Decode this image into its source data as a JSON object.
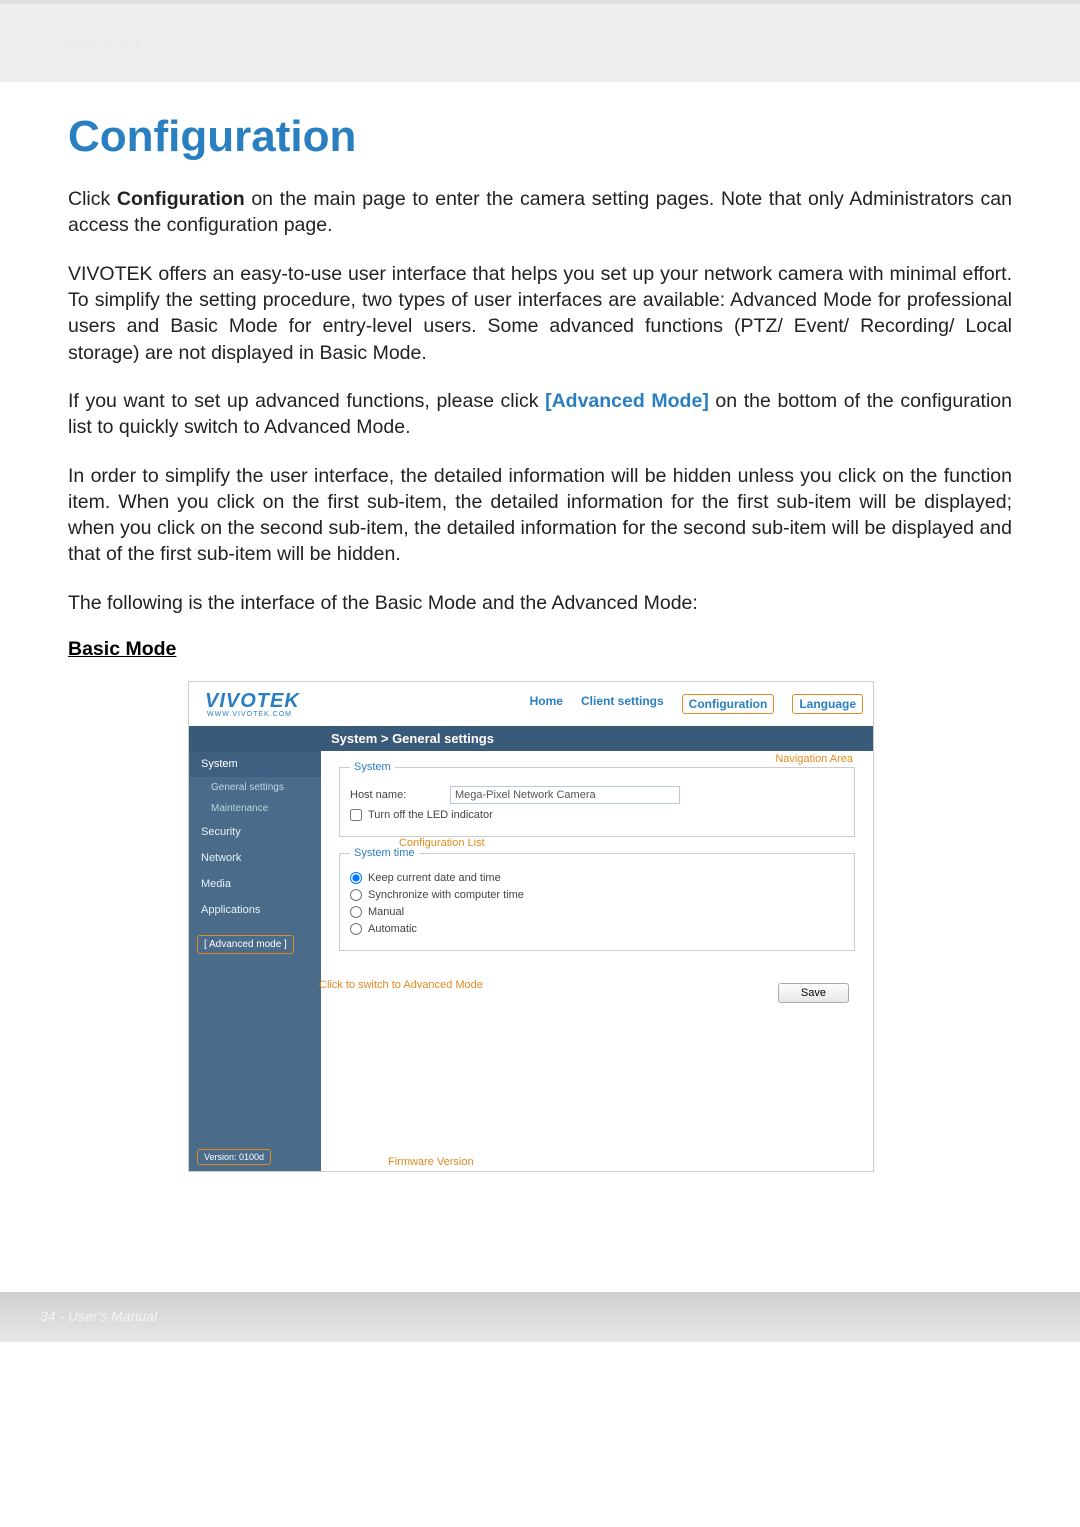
{
  "header": {
    "brand": "VIVOTEK"
  },
  "title": "Configuration",
  "paragraphs": {
    "p1_a": "Click ",
    "p1_b": "Configuration",
    "p1_c": " on the main page to enter the camera setting pages. Note that only Administrators can access the configuration page.",
    "p2": "VIVOTEK offers an easy-to-use user interface that helps you set up your network camera with minimal effort. To simplify the setting procedure, two types of user interfaces are available: Advanced Mode for professional users and Basic Mode for entry-level users. Some advanced functions (PTZ/ Event/ Recording/ Local storage) are not displayed in Basic Mode.",
    "p3_a": "If you want to set up advanced functions, please click ",
    "p3_b": "[Advanced Mode]",
    "p3_c": " on the bottom of the configuration list to quickly switch to Advanced Mode.",
    "p4": "In order to simplify the user interface, the detailed information will be hidden unless you click on the function item. When you click on the first sub-item, the detailed information for the first sub-item will be displayed; when you click on the second sub-item, the detailed information for the second sub-item will be displayed and that of the first sub-item will be hidden.",
    "p5": "The following is the interface of the Basic Mode and the Advanced Mode:"
  },
  "basic_mode_heading": "Basic Mode",
  "ui": {
    "logo": "VIVOTEK",
    "logo_sub": "WWW.VIVOTEK.COM",
    "nav": {
      "home": "Home",
      "client": "Client settings",
      "config": "Configuration",
      "language": "Language"
    },
    "breadcrumb": "System  >  General settings",
    "sidebar": {
      "system": "System",
      "general": "General settings",
      "maintenance": "Maintenance",
      "security": "Security",
      "network": "Network",
      "media": "Media",
      "applications": "Applications",
      "advanced_btn": "[ Advanced mode ]",
      "version": "Version: 0100d"
    },
    "fieldset1": {
      "legend": "System",
      "hostname_label": "Host name:",
      "hostname_value": "Mega-Pixel Network Camera",
      "led_label": "Turn off the LED indicator"
    },
    "fieldset2": {
      "legend": "System time",
      "opt1": "Keep current date and time",
      "opt2": "Synchronize with computer time",
      "opt3": "Manual",
      "opt4": "Automatic"
    },
    "save_btn": "Save",
    "annotations": {
      "nav_area": "Navigation Area",
      "config_list": "Configuration List",
      "adv_switch": "Click to switch to Advanced Mode",
      "fw_version": "Firmware Version"
    }
  },
  "footer": {
    "text": "34 - User's Manual"
  }
}
